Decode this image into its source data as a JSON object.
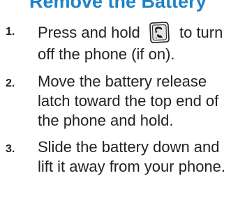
{
  "heading": "Remove the Battery",
  "steps": [
    {
      "number": "1.",
      "text_before_icon": "Press and hold",
      "icon": "end-power-key-icon",
      "text_after_icon": "to turn off the phone (if on)."
    },
    {
      "number": "2.",
      "text": "Move the battery release latch toward the top end of the phone and hold."
    },
    {
      "number": "3.",
      "text": "Slide the battery down and lift it away from your phone."
    }
  ],
  "colors": {
    "heading": "#1f82c9",
    "body_text": "#231f20"
  }
}
